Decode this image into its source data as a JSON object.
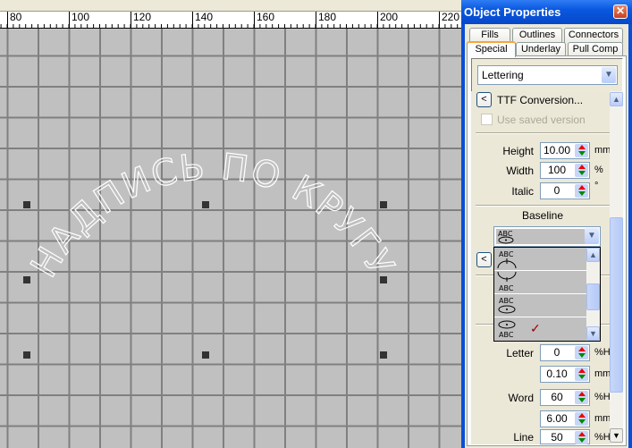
{
  "ruler": {
    "labels": [
      "80",
      "100",
      "120",
      "140",
      "160",
      "180",
      "200",
      "220"
    ]
  },
  "canvas": {
    "lettering_text": "НАДПИСЬ ПО КРУГУ"
  },
  "window": {
    "title": "Object Properties",
    "close_icon": "close-icon"
  },
  "tabs": {
    "row1": [
      "Fills",
      "Outlines",
      "Connectors"
    ],
    "row2": [
      "Special",
      "Underlay",
      "Pull Comp"
    ],
    "active": "Special"
  },
  "object_type": {
    "value": "Lettering"
  },
  "ttf": {
    "button": "<",
    "label": "TTF Conversion..."
  },
  "use_saved": {
    "label": "Use saved version",
    "checked": false,
    "disabled": true
  },
  "height": {
    "label": "Height",
    "value": "10.00",
    "unit": "mm"
  },
  "width": {
    "label": "Width",
    "value": "100",
    "unit": "%"
  },
  "italic": {
    "label": "Italic",
    "value": "0",
    "unit": "°"
  },
  "baseline": {
    "label": "Baseline",
    "selected_icon": "baseline-circle-icon",
    "options": [
      "baseline-arc-top-icon",
      "baseline-arc-bottom-icon",
      "baseline-circle-cw-icon",
      "baseline-circle-ccw-icon"
    ],
    "checked_option": "✓"
  },
  "second_button": "<",
  "letter": {
    "label": "Letter",
    "value": "0",
    "unit": "%H",
    "value2": "0.10",
    "unit2": "mm"
  },
  "word": {
    "label": "Word",
    "value": "60",
    "unit": "%H",
    "value2": "6.00",
    "unit2": "mm"
  },
  "line": {
    "label": "Line",
    "value": "50",
    "unit": "%H"
  },
  "colors": {
    "titlebar": "#0a58e0",
    "canvas": "#c0c0c0",
    "grid": "#808080"
  }
}
